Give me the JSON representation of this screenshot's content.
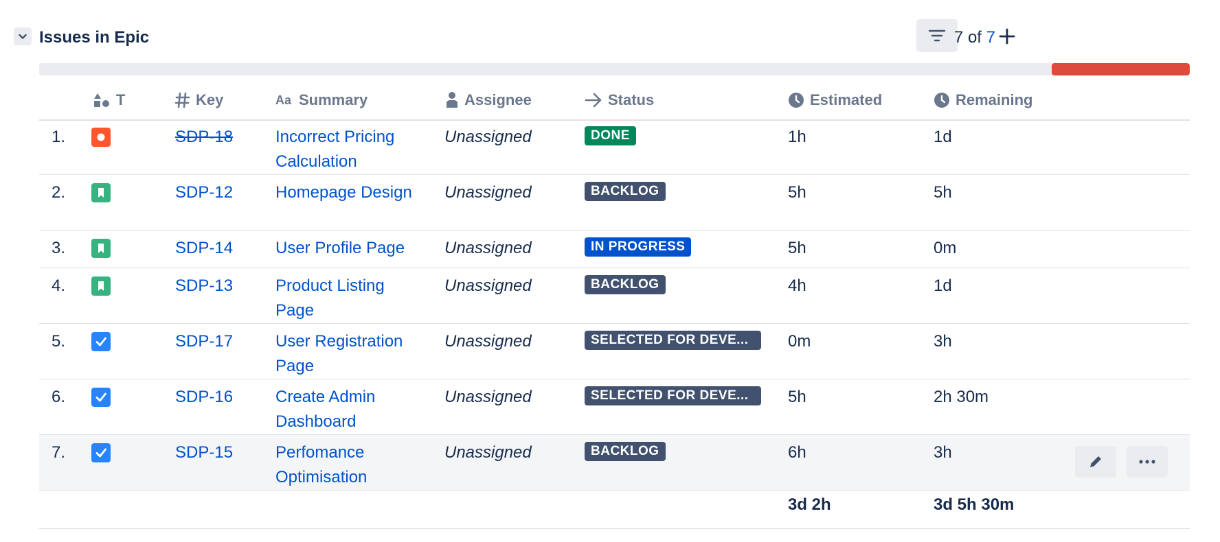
{
  "header": {
    "title": "Issues in Epic",
    "count_shown": "7",
    "count_of": "of",
    "count_total": "7"
  },
  "progress": {
    "done_fraction": 0.12,
    "color": "#de4a3c"
  },
  "columns": {
    "type": "T",
    "key": "Key",
    "summary": "Summary",
    "assignee": "Assignee",
    "status": "Status",
    "estimated": "Estimated",
    "remaining": "Remaining"
  },
  "rows": [
    {
      "num": "1.",
      "type": "bug-icon",
      "key": "SDP-18",
      "key_done": true,
      "summary": "Incorrect Pricing Calculation",
      "assignee": "Unassigned",
      "status": "DONE",
      "status_kind": "done",
      "estimated": "1h",
      "remaining": "1d"
    },
    {
      "num": "2.",
      "type": "story-icon",
      "key": "SDP-12",
      "key_done": false,
      "summary": "Homepage Design",
      "assignee": "Unassigned",
      "status": "BACKLOG",
      "status_kind": "backlog",
      "estimated": "5h",
      "remaining": "5h"
    },
    {
      "num": "3.",
      "type": "story-icon",
      "key": "SDP-14",
      "key_done": false,
      "summary": "User Profile Page",
      "assignee": "Unassigned",
      "status": "IN PROGRESS",
      "status_kind": "inprogress",
      "estimated": "5h",
      "remaining": "0m"
    },
    {
      "num": "4.",
      "type": "story-icon",
      "key": "SDP-13",
      "key_done": false,
      "summary": "Product Listing Page",
      "assignee": "Unassigned",
      "status": "BACKLOG",
      "status_kind": "backlog",
      "estimated": "4h",
      "remaining": "1d"
    },
    {
      "num": "5.",
      "type": "task-icon",
      "key": "SDP-17",
      "key_done": false,
      "summary": "User Registration Page",
      "assignee": "Unassigned",
      "status": "SELECTED FOR DEVE...",
      "status_kind": "selected",
      "estimated": "0m",
      "remaining": "3h"
    },
    {
      "num": "6.",
      "type": "task-icon",
      "key": "SDP-16",
      "key_done": false,
      "summary": "Create Admin Dashboard",
      "assignee": "Unassigned",
      "status": "SELECTED FOR DEVE...",
      "status_kind": "selected",
      "estimated": "5h",
      "remaining": "2h 30m"
    },
    {
      "num": "7.",
      "type": "task-icon",
      "key": "SDP-15",
      "key_done": false,
      "summary": "Perfomance Optimisation",
      "assignee": "Unassigned",
      "status": "BACKLOG",
      "status_kind": "backlog",
      "estimated": "6h",
      "remaining": "3h"
    }
  ],
  "totals": {
    "estimated": "3d 2h",
    "remaining": "3d 5h 30m"
  },
  "colors": {
    "link": "#0052cc",
    "done": "#00875a",
    "backlog": "#42526e",
    "in_progress": "#0052cc",
    "bug": "#ff5630",
    "story": "#36b37e",
    "task": "#2684ff"
  }
}
